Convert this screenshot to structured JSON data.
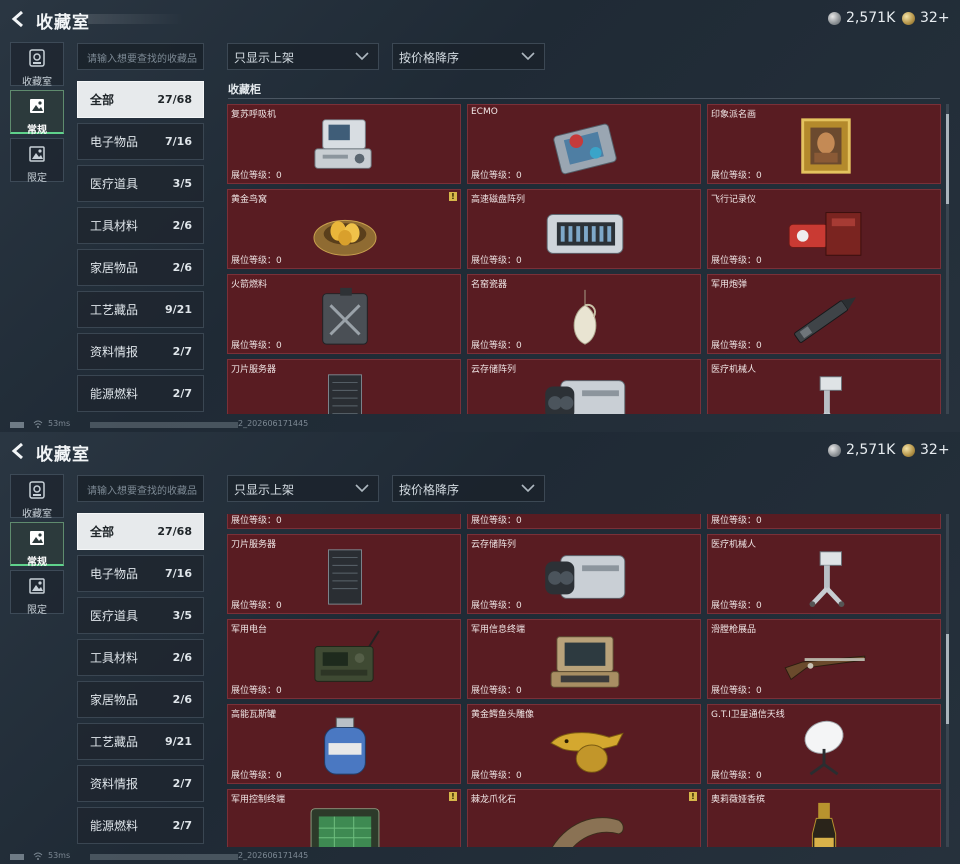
{
  "app": {
    "title": "收藏室",
    "currency_silver": "2,571K",
    "currency_gold": "32+"
  },
  "modes": [
    {
      "label": "收藏室",
      "icon": "vault-icon",
      "active": false
    },
    {
      "label": "常规",
      "icon": "image-icon",
      "active": true
    },
    {
      "label": "限定",
      "icon": "limited-image-icon",
      "active": false
    }
  ],
  "search": {
    "placeholder": "请输入想要查找的收藏品"
  },
  "filters": {
    "display_filter": "只显示上架",
    "sort_order": "按价格降序"
  },
  "categories": [
    {
      "label": "全部",
      "count": "27/68",
      "active": true
    },
    {
      "label": "电子物品",
      "count": "7/16"
    },
    {
      "label": "医疗道具",
      "count": "3/5"
    },
    {
      "label": "工具材料",
      "count": "2/6"
    },
    {
      "label": "家居物品",
      "count": "2/6"
    },
    {
      "label": "工艺藏品",
      "count": "9/21"
    },
    {
      "label": "资料情报",
      "count": "2/7"
    },
    {
      "label": "能源燃料",
      "count": "2/7"
    }
  ],
  "section_title": "收藏柜",
  "level_text": "展位等级：0",
  "items": [
    {
      "name": "复苏呼吸机",
      "icon": "ventilator-icon",
      "warning": false
    },
    {
      "name": "ECMO",
      "icon": "ecmo-icon",
      "warning": false
    },
    {
      "name": "印象派名画",
      "icon": "painting-icon",
      "warning": false
    },
    {
      "name": "黄金鸟窝",
      "icon": "golden-nest-icon",
      "warning": true
    },
    {
      "name": "高速磁盘阵列",
      "icon": "disk-array-icon",
      "warning": false
    },
    {
      "name": "飞行记录仪",
      "icon": "flight-recorder-icon",
      "warning": false
    },
    {
      "name": "火箭燃料",
      "icon": "fuel-can-icon",
      "warning": false
    },
    {
      "name": "名窑瓷器",
      "icon": "porcelain-vase-icon",
      "warning": false
    },
    {
      "name": "军用炮弹",
      "icon": "artillery-shell-icon",
      "warning": false
    },
    {
      "name": "刀片服务器",
      "icon": "blade-server-icon",
      "warning": false
    },
    {
      "name": "云存储阵列",
      "icon": "cloud-storage-icon",
      "warning": false
    },
    {
      "name": "医疗机械人",
      "icon": "medical-robot-icon",
      "warning": false
    },
    {
      "name": "军用电台",
      "icon": "military-radio-icon",
      "warning": false
    },
    {
      "name": "军用信息终端",
      "icon": "info-terminal-icon",
      "warning": false
    },
    {
      "name": "滑膛枪展品",
      "icon": "musket-icon",
      "warning": false
    },
    {
      "name": "高能瓦斯罐",
      "icon": "gas-canister-icon",
      "warning": false
    },
    {
      "name": "黄金鳄鱼头雕像",
      "icon": "gold-croc-statue-icon",
      "warning": false
    },
    {
      "name": "G.T.I卫星通信天线",
      "icon": "satellite-dish-icon",
      "warning": false
    },
    {
      "name": "军用控制终端",
      "icon": "control-terminal-icon",
      "warning": true
    },
    {
      "name": "棘龙爪化石",
      "icon": "claw-fossil-icon",
      "warning": true
    },
    {
      "name": "奥莉薇娅香槟",
      "icon": "champagne-icon",
      "warning": false
    }
  ],
  "status": {
    "ping": "53ms",
    "uid_suffix": "2_202606171445"
  },
  "colors": {
    "card_bg": "#591c22",
    "active_green": "#5fd28c",
    "warning": "#d6b84a"
  }
}
